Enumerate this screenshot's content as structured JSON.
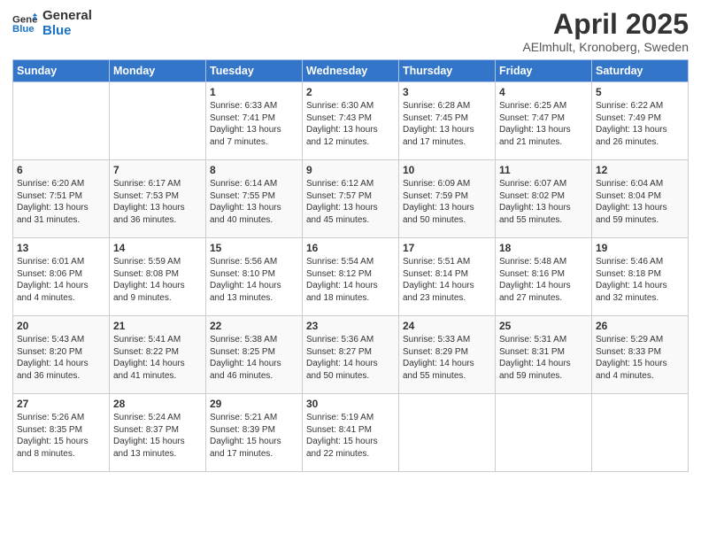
{
  "header": {
    "logo_line1": "General",
    "logo_line2": "Blue",
    "title": "April 2025",
    "subtitle": "AElmhult, Kronoberg, Sweden"
  },
  "days_of_week": [
    "Sunday",
    "Monday",
    "Tuesday",
    "Wednesday",
    "Thursday",
    "Friday",
    "Saturday"
  ],
  "weeks": [
    [
      {
        "day": "",
        "info": ""
      },
      {
        "day": "",
        "info": ""
      },
      {
        "day": "1",
        "info": "Sunrise: 6:33 AM\nSunset: 7:41 PM\nDaylight: 13 hours and 7 minutes."
      },
      {
        "day": "2",
        "info": "Sunrise: 6:30 AM\nSunset: 7:43 PM\nDaylight: 13 hours and 12 minutes."
      },
      {
        "day": "3",
        "info": "Sunrise: 6:28 AM\nSunset: 7:45 PM\nDaylight: 13 hours and 17 minutes."
      },
      {
        "day": "4",
        "info": "Sunrise: 6:25 AM\nSunset: 7:47 PM\nDaylight: 13 hours and 21 minutes."
      },
      {
        "day": "5",
        "info": "Sunrise: 6:22 AM\nSunset: 7:49 PM\nDaylight: 13 hours and 26 minutes."
      }
    ],
    [
      {
        "day": "6",
        "info": "Sunrise: 6:20 AM\nSunset: 7:51 PM\nDaylight: 13 hours and 31 minutes."
      },
      {
        "day": "7",
        "info": "Sunrise: 6:17 AM\nSunset: 7:53 PM\nDaylight: 13 hours and 36 minutes."
      },
      {
        "day": "8",
        "info": "Sunrise: 6:14 AM\nSunset: 7:55 PM\nDaylight: 13 hours and 40 minutes."
      },
      {
        "day": "9",
        "info": "Sunrise: 6:12 AM\nSunset: 7:57 PM\nDaylight: 13 hours and 45 minutes."
      },
      {
        "day": "10",
        "info": "Sunrise: 6:09 AM\nSunset: 7:59 PM\nDaylight: 13 hours and 50 minutes."
      },
      {
        "day": "11",
        "info": "Sunrise: 6:07 AM\nSunset: 8:02 PM\nDaylight: 13 hours and 55 minutes."
      },
      {
        "day": "12",
        "info": "Sunrise: 6:04 AM\nSunset: 8:04 PM\nDaylight: 13 hours and 59 minutes."
      }
    ],
    [
      {
        "day": "13",
        "info": "Sunrise: 6:01 AM\nSunset: 8:06 PM\nDaylight: 14 hours and 4 minutes."
      },
      {
        "day": "14",
        "info": "Sunrise: 5:59 AM\nSunset: 8:08 PM\nDaylight: 14 hours and 9 minutes."
      },
      {
        "day": "15",
        "info": "Sunrise: 5:56 AM\nSunset: 8:10 PM\nDaylight: 14 hours and 13 minutes."
      },
      {
        "day": "16",
        "info": "Sunrise: 5:54 AM\nSunset: 8:12 PM\nDaylight: 14 hours and 18 minutes."
      },
      {
        "day": "17",
        "info": "Sunrise: 5:51 AM\nSunset: 8:14 PM\nDaylight: 14 hours and 23 minutes."
      },
      {
        "day": "18",
        "info": "Sunrise: 5:48 AM\nSunset: 8:16 PM\nDaylight: 14 hours and 27 minutes."
      },
      {
        "day": "19",
        "info": "Sunrise: 5:46 AM\nSunset: 8:18 PM\nDaylight: 14 hours and 32 minutes."
      }
    ],
    [
      {
        "day": "20",
        "info": "Sunrise: 5:43 AM\nSunset: 8:20 PM\nDaylight: 14 hours and 36 minutes."
      },
      {
        "day": "21",
        "info": "Sunrise: 5:41 AM\nSunset: 8:22 PM\nDaylight: 14 hours and 41 minutes."
      },
      {
        "day": "22",
        "info": "Sunrise: 5:38 AM\nSunset: 8:25 PM\nDaylight: 14 hours and 46 minutes."
      },
      {
        "day": "23",
        "info": "Sunrise: 5:36 AM\nSunset: 8:27 PM\nDaylight: 14 hours and 50 minutes."
      },
      {
        "day": "24",
        "info": "Sunrise: 5:33 AM\nSunset: 8:29 PM\nDaylight: 14 hours and 55 minutes."
      },
      {
        "day": "25",
        "info": "Sunrise: 5:31 AM\nSunset: 8:31 PM\nDaylight: 14 hours and 59 minutes."
      },
      {
        "day": "26",
        "info": "Sunrise: 5:29 AM\nSunset: 8:33 PM\nDaylight: 15 hours and 4 minutes."
      }
    ],
    [
      {
        "day": "27",
        "info": "Sunrise: 5:26 AM\nSunset: 8:35 PM\nDaylight: 15 hours and 8 minutes."
      },
      {
        "day": "28",
        "info": "Sunrise: 5:24 AM\nSunset: 8:37 PM\nDaylight: 15 hours and 13 minutes."
      },
      {
        "day": "29",
        "info": "Sunrise: 5:21 AM\nSunset: 8:39 PM\nDaylight: 15 hours and 17 minutes."
      },
      {
        "day": "30",
        "info": "Sunrise: 5:19 AM\nSunset: 8:41 PM\nDaylight: 15 hours and 22 minutes."
      },
      {
        "day": "",
        "info": ""
      },
      {
        "day": "",
        "info": ""
      },
      {
        "day": "",
        "info": ""
      }
    ]
  ]
}
